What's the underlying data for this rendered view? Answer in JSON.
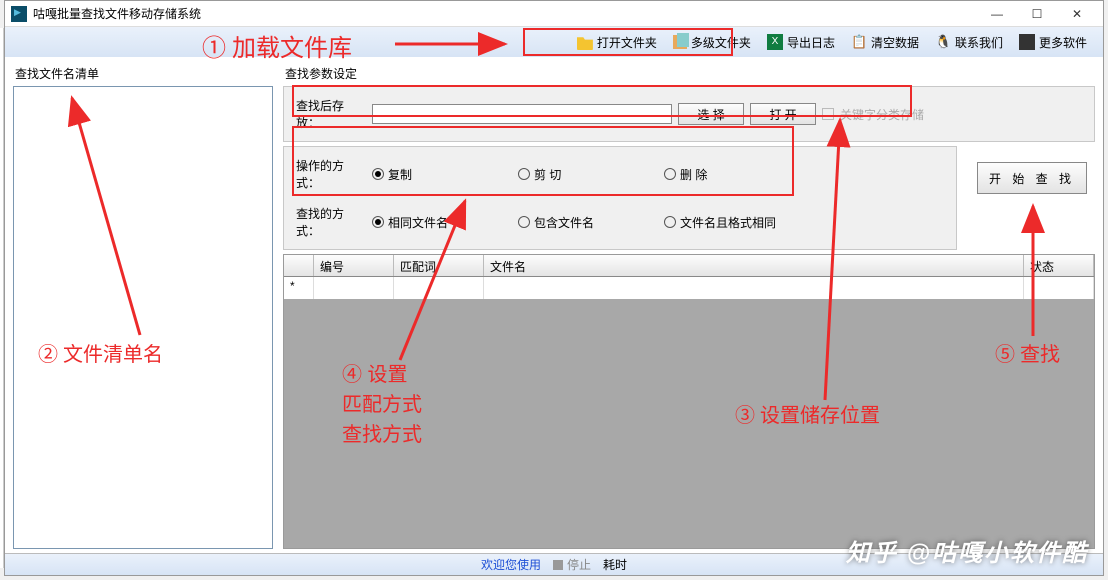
{
  "title": "咕嘎批量查找文件移动存储系统",
  "toolbar": {
    "open_folder": "打开文件夹",
    "multi_folder": "多级文件夹",
    "export_log": "导出日志",
    "clear_data": "清空数据",
    "contact_us": "联系我们",
    "more_soft": "更多软件"
  },
  "left_panel_title": "查找文件名清单",
  "params_title": "查找参数设定",
  "store_row": {
    "label": "查找后存放：",
    "value": "",
    "select_btn": "选 择",
    "open_btn": "打 开",
    "keyword_check": "关键字分类存储"
  },
  "op_mode": {
    "label": "操作的方式：",
    "copy": "复制",
    "cut": "剪 切",
    "delete": "删 除"
  },
  "find_mode": {
    "label": "查找的方式：",
    "same": "相同文件名",
    "contain": "包含文件名",
    "same_fmt": "文件名且格式相同"
  },
  "start_btn": "开 始 查 找",
  "grid": {
    "col_blank": "",
    "col_no": "编号",
    "col_match": "匹配词",
    "col_name": "文件名",
    "col_state": "状态",
    "row_marker": "*"
  },
  "status": {
    "welcome": "欢迎您使用",
    "stop": "停止",
    "time": "耗时"
  },
  "annotations": {
    "a1": "① 加载文件库",
    "a2": "② 文件清单名",
    "a3": "③ 设置储存位置",
    "a4a": "④ 设置",
    "a4b": "匹配方式",
    "a4c": "查找方式",
    "a5": "⑤ 查找"
  },
  "watermark": "知乎 @咕嘎小软件酷"
}
